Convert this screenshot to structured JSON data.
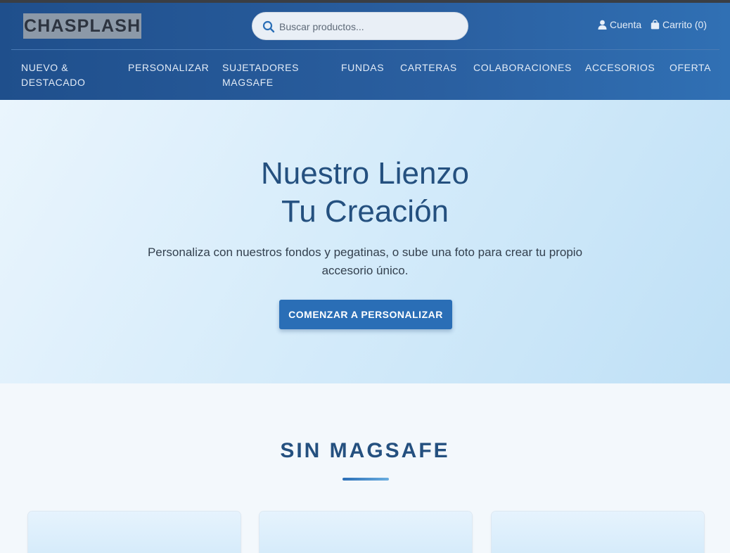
{
  "header": {
    "logo": "CHASPLASH",
    "search": {
      "placeholder": "Buscar productos..."
    },
    "account_label": "Cuenta",
    "cart_label": "Carrito (0)"
  },
  "nav": {
    "items": [
      {
        "line1": "NUEVO &",
        "line2": "DESTACADO"
      },
      {
        "line1": "PERSONALIZAR",
        "line2": ""
      },
      {
        "line1": "SUJETADORES",
        "line2": "MAGSAFE"
      },
      {
        "line1": "FUNDAS",
        "line2": ""
      },
      {
        "line1": "CARTERAS",
        "line2": ""
      },
      {
        "line1": "COLABORACIONES",
        "line2": ""
      },
      {
        "line1": "ACCESORIOS",
        "line2": ""
      },
      {
        "line1": "OFERTA",
        "line2": ""
      }
    ]
  },
  "hero": {
    "title_line1": "Nuestro Lienzo",
    "title_line2": "Tu Creación",
    "subtitle": "Personaliza con nuestros fondos y pegatinas, o sube una foto para crear tu propio accesorio único.",
    "cta_label": "COMENZAR A PERSONALIZAR"
  },
  "section": {
    "title": "SIN MAGSAFE"
  },
  "icons": {
    "search": "search-icon",
    "account": "user-icon",
    "cart": "shopping-bag-icon"
  },
  "colors": {
    "header": "#2a5fa0",
    "accent": "#2a6eb6",
    "heading": "#24507f"
  }
}
